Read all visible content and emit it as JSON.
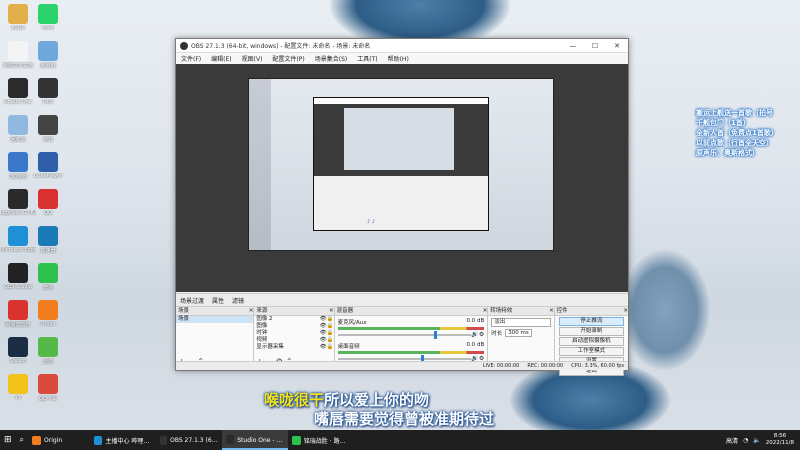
{
  "desktop": {
    "icons": [
      {
        "label": "ASUS",
        "color": "#e2b04a"
      },
      {
        "label": "kook",
        "color": "#2bd46a"
      },
      {
        "label": "新建文本文档",
        "color": "#f4f4f4"
      },
      {
        "label": "此电脑",
        "color": "#6fa8dc"
      },
      {
        "label": "Studio One",
        "color": "#2b2b2b"
      },
      {
        "label": "OBS",
        "color": "#333333"
      },
      {
        "label": "回收站",
        "color": "#8fb9e0"
      },
      {
        "label": "游戏",
        "color": "#444444"
      },
      {
        "label": "QQ游戏",
        "color": "#3a78c9"
      },
      {
        "label": "ConePlayer",
        "color": "#2f5fa8"
      },
      {
        "label": "Logitech G HUB",
        "color": "#2a2a2a"
      },
      {
        "label": "QQ",
        "color": "#d93030"
      },
      {
        "label": "Microsoft Edge",
        "color": "#1f8fd6"
      },
      {
        "label": "加速器",
        "color": "#1a7ab8"
      },
      {
        "label": "OBS Studio",
        "color": "#222222"
      },
      {
        "label": "微信",
        "color": "#2dc14d"
      },
      {
        "label": "网易云音乐",
        "color": "#d8332f"
      },
      {
        "label": "Origin",
        "color": "#f27d1e"
      },
      {
        "label": "Steam",
        "color": "#1b2c45"
      },
      {
        "label": "迅游",
        "color": "#55b947"
      },
      {
        "label": "YY",
        "color": "#f3c21a"
      },
      {
        "label": "QQ飞车",
        "color": "#d94a3c"
      }
    ],
    "note_lines": [
      "搬运上舰送一首歌（拍号",
      "千舰包门（1首）",
      "全新人首（免费点1首歌）",
      "以前点歌（行首全天空）",
      "原声乐：奥斯格式）"
    ],
    "lyric_line1_hl": "喉咙很干",
    "lyric_line1_rest": "所以爱上你的吻",
    "lyric_line2": "嘴唇需要觉得曾被准期待过"
  },
  "obs": {
    "title": "OBS 27.1.3 (64-bit, windows) - 配置文件: 未命名 - 场景: 未命名",
    "menu": [
      "文件(F)",
      "编辑(E)",
      "视图(V)",
      "配置文件(P)",
      "场景集合(S)",
      "工具(T)",
      "帮助(H)"
    ],
    "tabs": [
      "场景过渡",
      "属性",
      "滤镜"
    ],
    "scenes_header": "场景",
    "scenes": [
      "场景"
    ],
    "sources_header": "来源",
    "sources": [
      "图像 2",
      "图像",
      "时钟",
      "视频",
      "显示器采集"
    ],
    "mixer_header": "混音器",
    "mixer_tracks": [
      {
        "name": "麦克风/Aux",
        "db": "0.0 dB",
        "level": 0.72
      },
      {
        "name": "桌面音频",
        "db": "0.0 dB",
        "level": 0.62
      }
    ],
    "transitions_header": "转场特效",
    "transition_value": "淡出",
    "duration_label": "时长",
    "duration_value": "300 ms",
    "controls_header": "控件",
    "controls": [
      "停止推流",
      "开始录制",
      "启动虚拟摄像机",
      "工作室模式",
      "设置",
      "退出"
    ],
    "status": [
      "LIVE: 00:00:00",
      "REC: 00:00:00",
      "CPU: 3.3%, 60.00 fps"
    ]
  },
  "taskbar": {
    "items": [
      {
        "label": "Origin",
        "color": "#f27d1e",
        "active": false
      },
      {
        "label": "主播中心 哔哩哔哩",
        "color": "#1f8fd6",
        "active": false
      },
      {
        "label": "OBS 27.1.3 (64-bit...",
        "color": "#333333",
        "active": false
      },
      {
        "label": "Studio One - 效果",
        "color": "#2b2b2b",
        "active": true
      },
      {
        "label": "铭瑞战胜 · 路由器",
        "color": "#2dc14d",
        "active": false
      }
    ],
    "tray_text": "高清",
    "time": "8:56",
    "date": "2022/11/8"
  }
}
